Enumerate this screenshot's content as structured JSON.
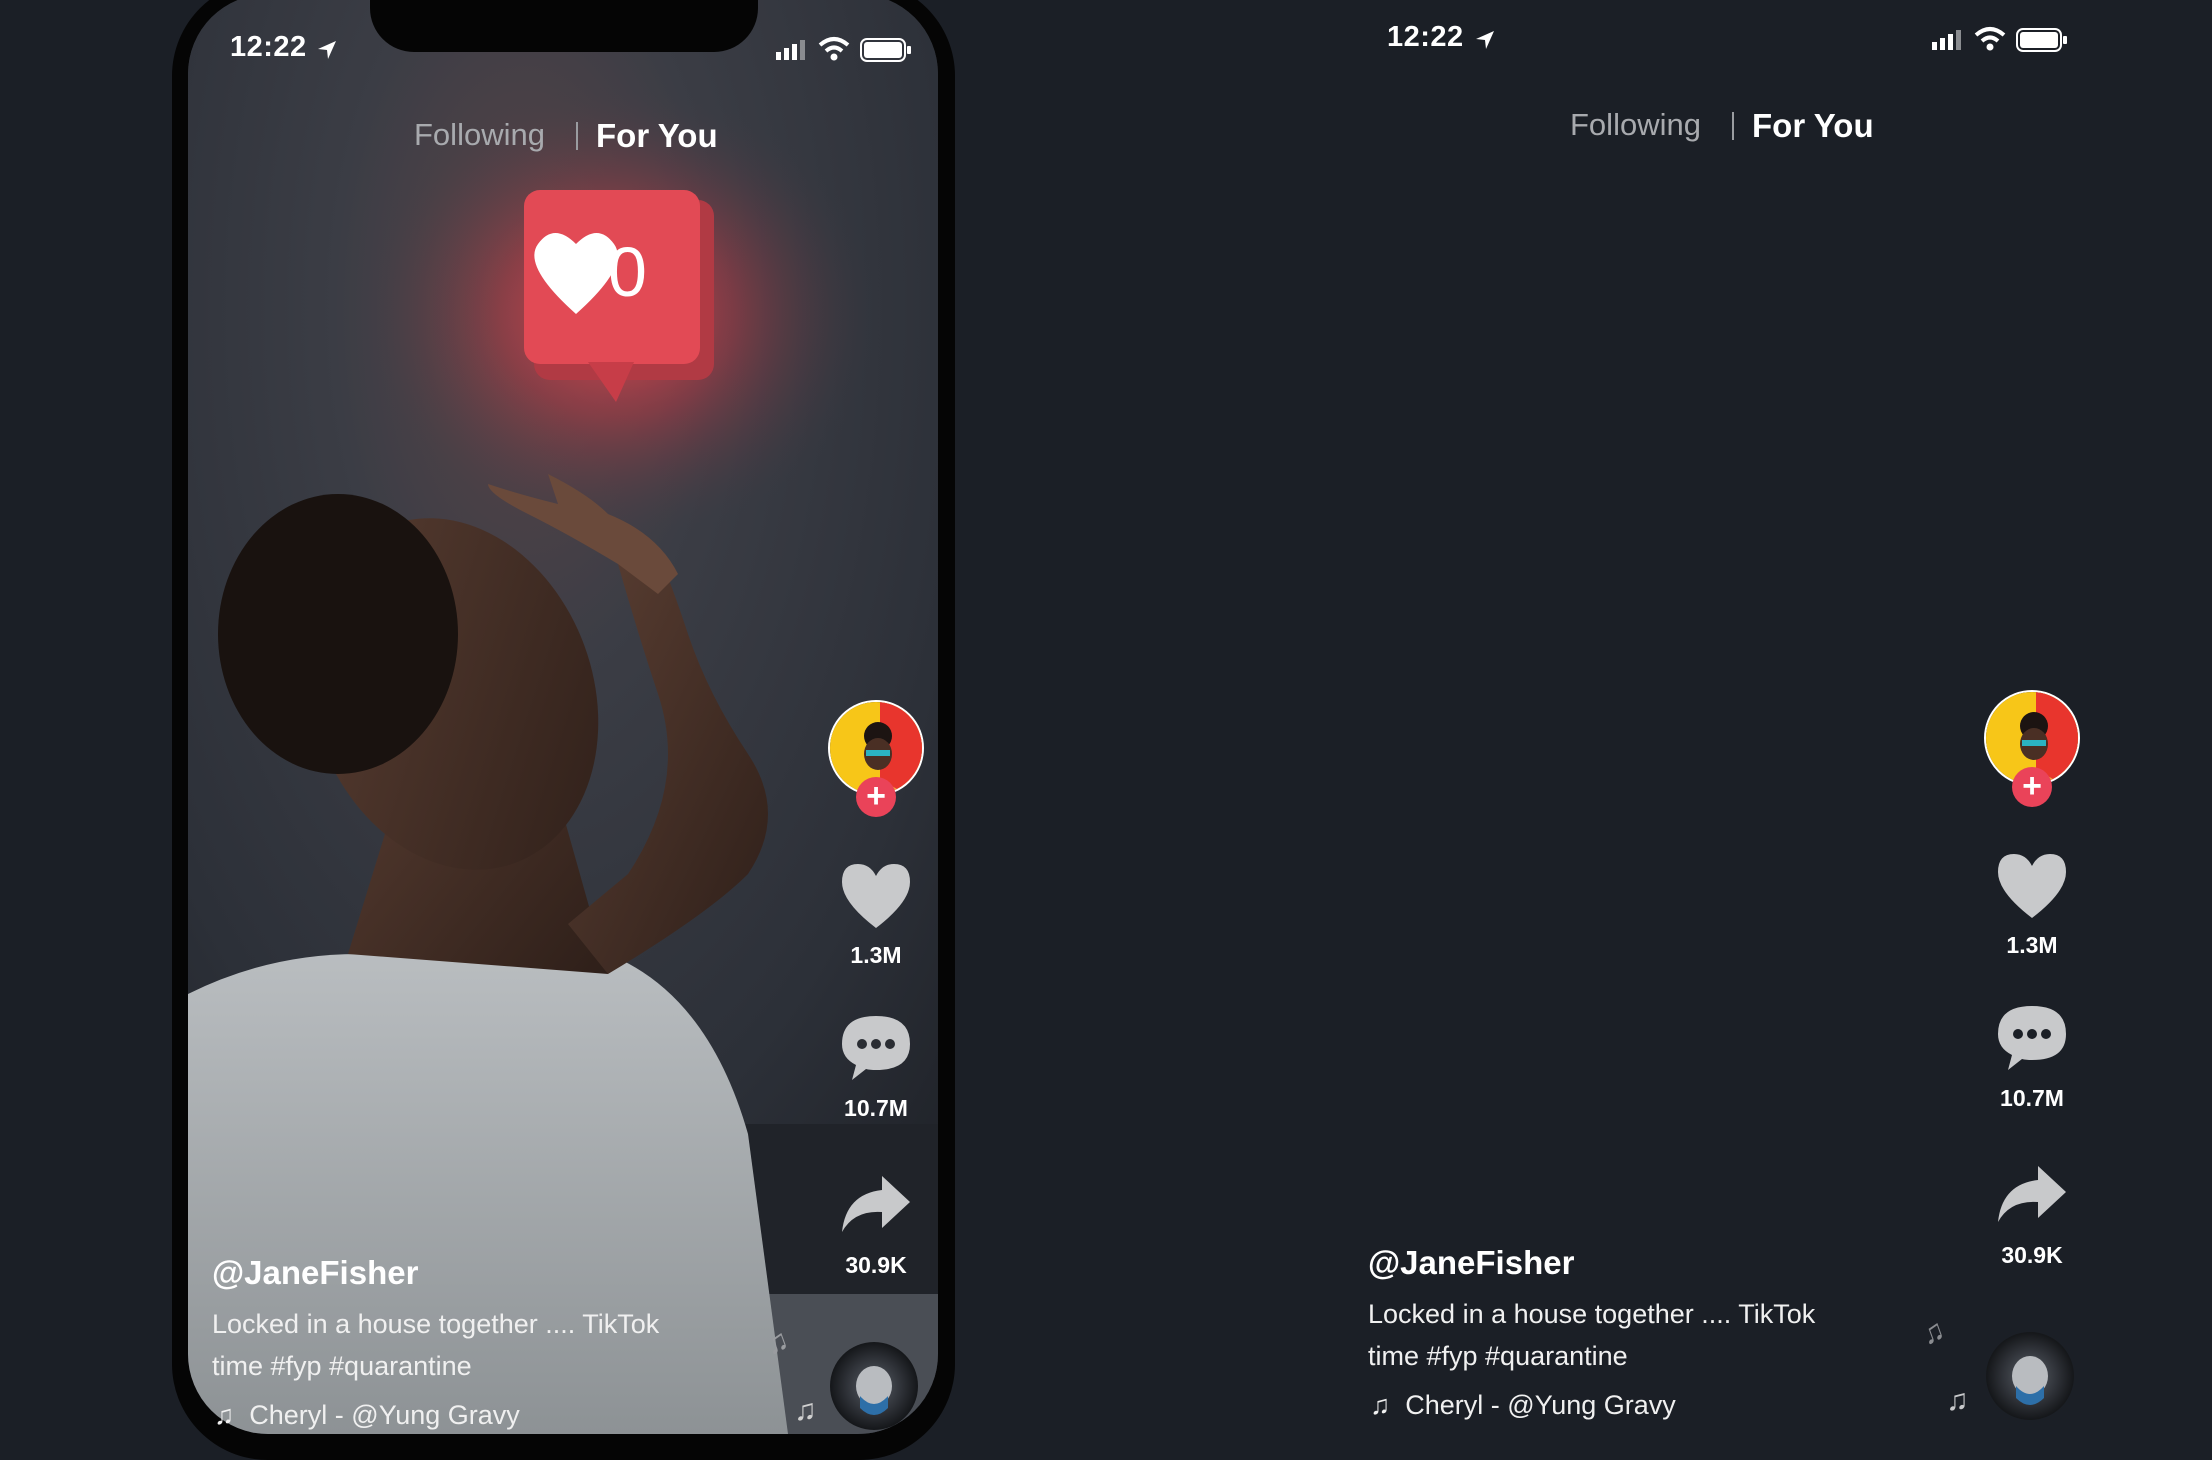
{
  "status_bar": {
    "time": "12:22"
  },
  "feed_tabs": {
    "following": "Following",
    "for_you": "For You"
  },
  "notification_badge": {
    "count": "0"
  },
  "actions": {
    "likes": "1.3M",
    "comments": "10.7M",
    "shares": "30.9K"
  },
  "post": {
    "username": "@JaneFisher",
    "caption_line1": "Locked in a house together .... TikTok",
    "caption_line2": "time #fyp #quarantine",
    "music": "Cheryl - @Yung Gravy"
  },
  "colors": {
    "background": "#1b1f26",
    "accent": "#ea4359",
    "icon_gray": "#c8c9cb",
    "glow": "#e2424f"
  }
}
